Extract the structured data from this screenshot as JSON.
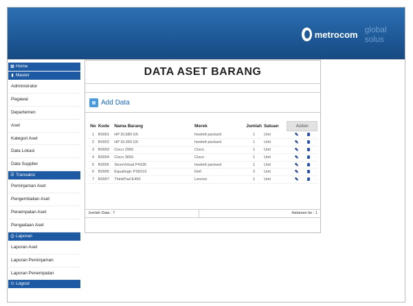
{
  "brand": {
    "name": "metrocom",
    "tagline": "global solus"
  },
  "sidebar": {
    "home": "Home",
    "master": "Master",
    "master_items": [
      "Administrator",
      "Pegawai",
      "Departemen",
      "Aset",
      "Kategori Aset",
      "Data Lokasi",
      "Data Supplier"
    ],
    "transaksi": "Transaksi",
    "transaksi_items": [
      "Peminjaman Aset",
      "Pengembalian Aset",
      "Penempatan Aset",
      "Pengadaan Aset"
    ],
    "laporan": "Laporan",
    "laporan_items": [
      "Laporan Aset",
      "Laporan Peminjaman",
      "Laporan Penempatan"
    ],
    "logout": "Logout"
  },
  "main": {
    "title": "DATA ASET BARANG",
    "add_label": "Add Data",
    "columns": [
      "No",
      "Kode",
      "Nama Barang",
      "Merek",
      "Jumlah",
      "Satuan",
      "Action"
    ],
    "rows": [
      [
        "1",
        "B0001",
        "HP DL580 G5",
        "hewlett packard",
        "1",
        "Unit"
      ],
      [
        "2",
        "B0002",
        "HP DL360 G5",
        "hewlett packard",
        "1",
        "Unit"
      ],
      [
        "3",
        "B0003",
        "Cisco 2950",
        "Cisco",
        "1",
        "Unit"
      ],
      [
        "4",
        "B0004",
        "Cisco 3650",
        "Cisco",
        "1",
        "Unit"
      ],
      [
        "5",
        "B0005",
        "StoreVirtual P4330",
        "hewlett packard",
        "1",
        "Unit"
      ],
      [
        "6",
        "B0006",
        "Equallogic PS6210",
        "Dell",
        "2",
        "Unit"
      ],
      [
        "7",
        "B0007",
        "ThinkPad E450",
        "Lenovo",
        "1",
        "Unit"
      ]
    ],
    "footer_left": "Jumlah Data : 7",
    "footer_right": "Halaman ke : 1"
  }
}
